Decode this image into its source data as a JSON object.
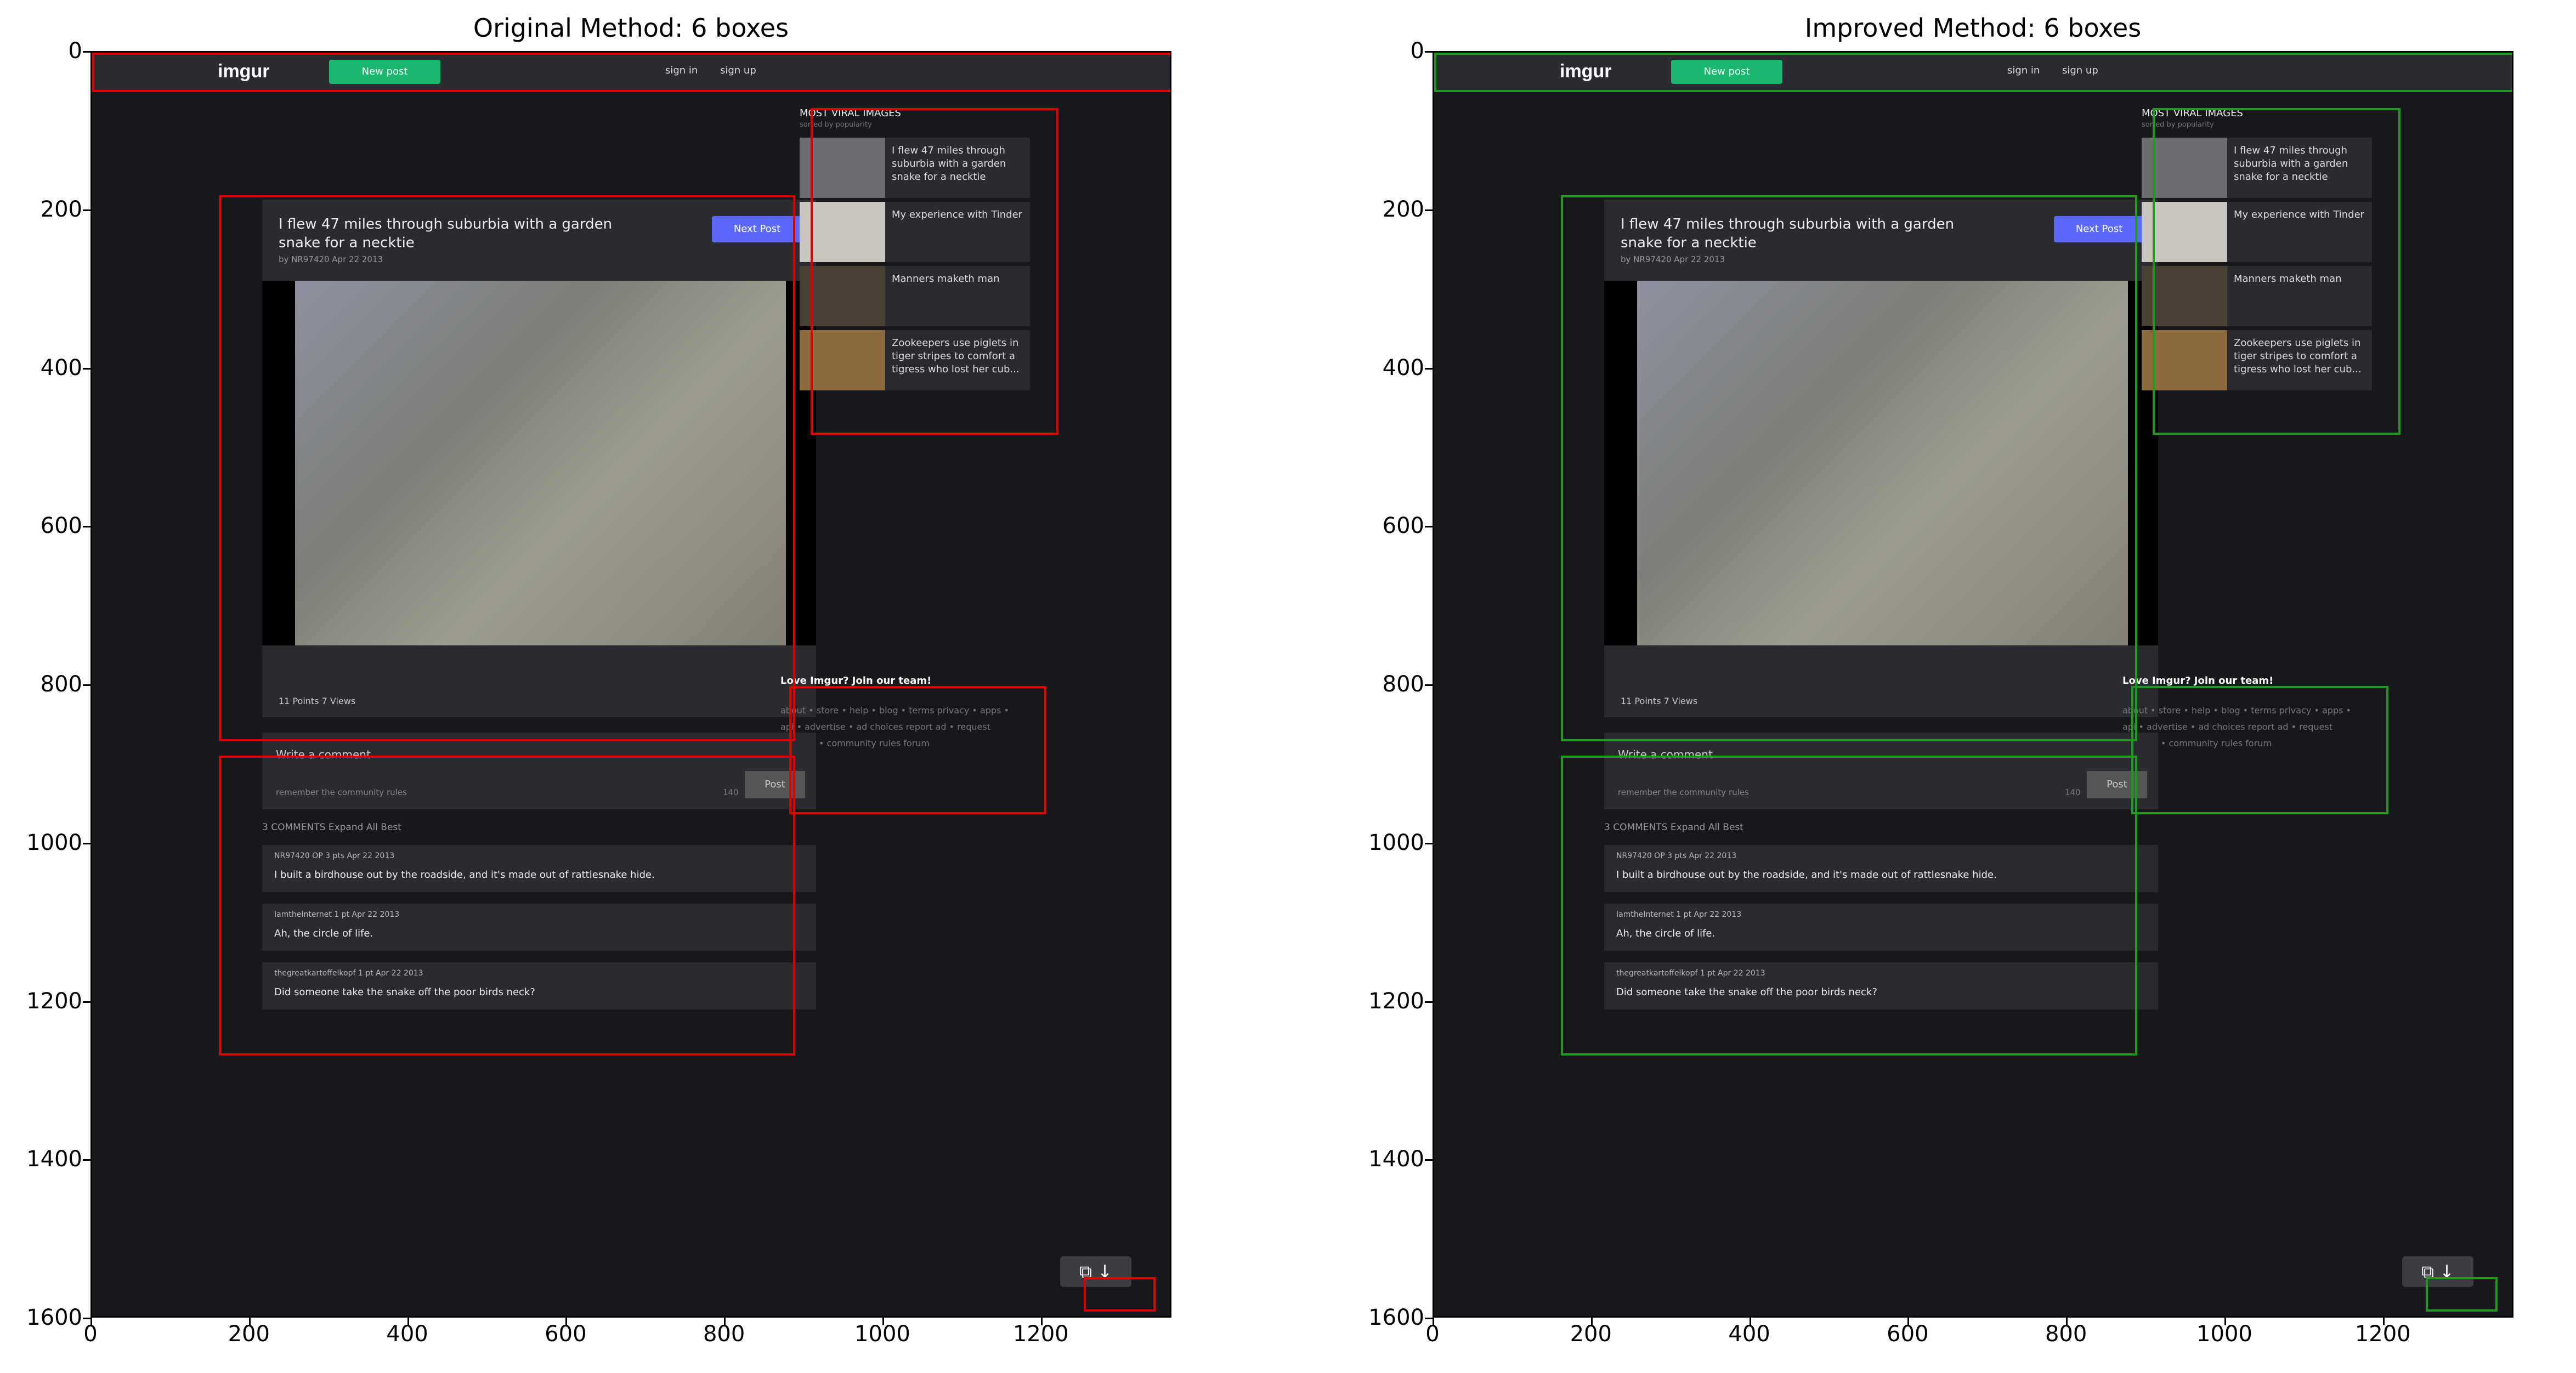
{
  "chart_data": [
    {
      "type": "image-with-boxes",
      "title": "Original Method: 6 boxes",
      "xlim": [
        0,
        1365
      ],
      "ylim": [
        1600,
        0
      ],
      "x_ticks": [
        0,
        200,
        400,
        600,
        800,
        1000,
        1200
      ],
      "y_ticks": [
        0,
        200,
        400,
        600,
        800,
        1000,
        1200,
        1400,
        1600
      ],
      "box_color": "#e00000",
      "boxes": [
        {
          "x0": 0,
          "y0": 0,
          "x1": 1365,
          "y1": 50
        },
        {
          "x0": 907,
          "y0": 70,
          "x1": 1220,
          "y1": 483
        },
        {
          "x0": 160,
          "y0": 180,
          "x1": 888,
          "y1": 870
        },
        {
          "x0": 880,
          "y0": 800,
          "x1": 1205,
          "y1": 962
        },
        {
          "x0": 160,
          "y0": 888,
          "x1": 888,
          "y1": 1267
        },
        {
          "x0": 1252,
          "y0": 1547,
          "x1": 1343,
          "y1": 1590
        }
      ]
    },
    {
      "type": "image-with-boxes",
      "title": "Improved Method: 6 boxes",
      "xlim": [
        0,
        1365
      ],
      "ylim": [
        1600,
        0
      ],
      "x_ticks": [
        0,
        200,
        400,
        600,
        800,
        1000,
        1200
      ],
      "y_ticks": [
        0,
        200,
        400,
        600,
        800,
        1000,
        1200,
        1400,
        1600
      ],
      "box_color": "#1f9a1f",
      "boxes": [
        {
          "x0": 0,
          "y0": 0,
          "x1": 1365,
          "y1": 50
        },
        {
          "x0": 907,
          "y0": 70,
          "x1": 1220,
          "y1": 483
        },
        {
          "x0": 160,
          "y0": 180,
          "x1": 888,
          "y1": 870
        },
        {
          "x0": 880,
          "y0": 800,
          "x1": 1205,
          "y1": 962
        },
        {
          "x0": 160,
          "y0": 888,
          "x1": 888,
          "y1": 1267
        },
        {
          "x0": 1252,
          "y0": 1547,
          "x1": 1343,
          "y1": 1590
        }
      ]
    }
  ],
  "screenshot": {
    "logo": "imgur",
    "new_post": "New post",
    "sign_in": "sign in",
    "sign_up": "sign up",
    "post_title": "I flew 47 miles through suburbia with a garden snake for a necktie",
    "post_by": "by NR97420   Apr 22 2013",
    "next_post": "Next Post",
    "post_stats": "11 Points      7 Views",
    "viral_title": "MOST VIRAL IMAGES",
    "viral_sub": "sorted by popularity",
    "viral_items": [
      "I flew 47 miles through suburbia with a garden snake for a necktie",
      "My experience with Tinder",
      "Manners maketh man",
      "Zookeepers use piglets in tiger stripes to comfort a tigress who lost her cub..."
    ],
    "footer_title": "Love Imgur? Join our team!",
    "footer_links": "about • store • help • blog • terms privacy • apps • api • advertise • ad choices report ad • request deletion • community rules forum",
    "comment_placeholder": "Write a comment",
    "comment_rules": "remember the community rules",
    "comment_count": "140",
    "comment_post": "Post",
    "comments_header": "3 COMMENTS                                                            Expand All        Best",
    "comments": [
      {
        "meta": "NR97420  OP   3 pts   Apr 22 2013",
        "body": "I built a birdhouse out by the roadside, and it's made out of rattlesnake hide."
      },
      {
        "meta": "IamtheInternet   1 pt   Apr 22 2013",
        "body": "Ah, the circle of life."
      },
      {
        "meta": "thegreatkartoffelkopf   1 pt   Apr 22 2013",
        "body": "Did someone take the snake off the poor birds neck?"
      }
    ]
  }
}
